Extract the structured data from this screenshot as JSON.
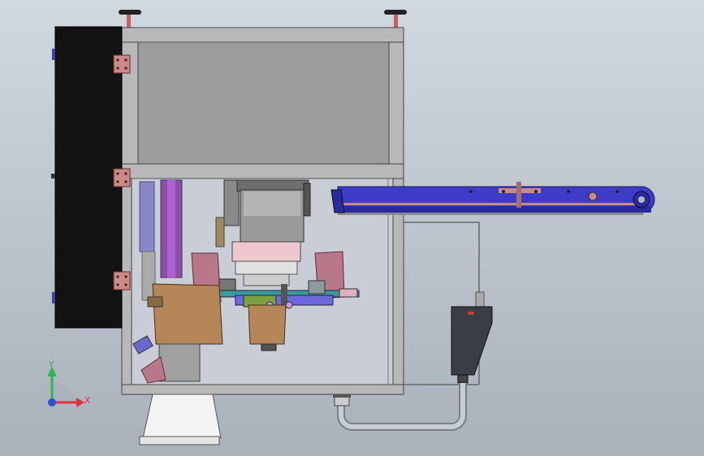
{
  "triad": {
    "x_label": "X",
    "y_label": "Y",
    "colors": {
      "x": "#e0303a",
      "y": "#2db84b",
      "origin": "#3050d0"
    }
  },
  "colors": {
    "background_top": "#d2d8df",
    "background_bottom": "#a9b1bb",
    "frame": "#9a9a9a",
    "side_panel": "#111111",
    "hinge": "#c98b86",
    "conveyor": "#3c3cc8",
    "hopper": "#b48658",
    "guard": "#b9778a",
    "control_box": "#3b3d44",
    "pipe": "#b9bec6"
  }
}
